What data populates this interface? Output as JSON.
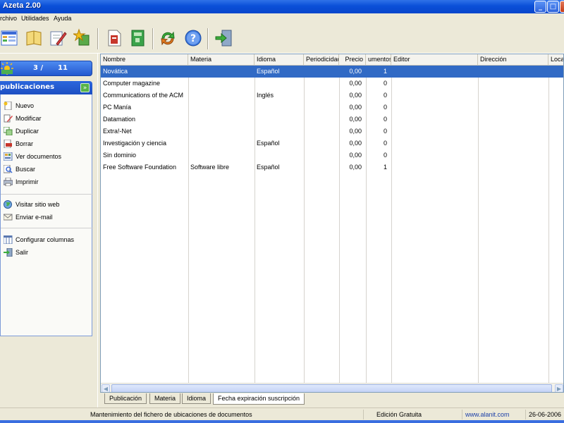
{
  "window": {
    "title": "Azeta 2.00"
  },
  "menu": {
    "items": [
      "rchivo",
      "Utilidades",
      "Ayuda"
    ]
  },
  "toolbar": {
    "buttons": [
      {
        "icon": "grid-view-icon"
      },
      {
        "icon": "book-icon"
      },
      {
        "icon": "edit-pencil-icon"
      },
      {
        "icon": "sparkle-star-icon"
      },
      {
        "icon": "document-icon"
      },
      {
        "icon": "green-book-icon"
      },
      {
        "icon": "refresh-arrows-icon"
      },
      {
        "icon": "help-question-icon"
      },
      {
        "icon": "exit-door-icon"
      }
    ]
  },
  "navigator": {
    "counter": "3 /      11"
  },
  "panel": {
    "header": "publicaciones",
    "actions": [
      "Nuevo",
      "Modificar",
      "Duplicar",
      "Borrar",
      "Ver documentos",
      "Buscar",
      "Imprimir"
    ],
    "web": [
      "Visitar sitio web",
      "Enviar e-mail"
    ],
    "system": [
      "Configurar columnas",
      "Salir"
    ]
  },
  "table": {
    "columns": [
      "Nombre",
      "Materia",
      "Idioma",
      "Periodicidad",
      "Precio",
      "umentos",
      "Editor",
      "Dirección",
      "Loca"
    ],
    "rows": [
      {
        "nombre": "Novática",
        "materia": "",
        "idioma": "Español",
        "periodicidad": "",
        "precio": "0,00",
        "documentos": "1",
        "selected": true
      },
      {
        "nombre": "Computer magazine",
        "materia": "",
        "idioma": "",
        "periodicidad": "",
        "precio": "0,00",
        "documentos": "0"
      },
      {
        "nombre": "Communications of the ACM",
        "materia": "",
        "idioma": "Inglés",
        "periodicidad": "",
        "precio": "0,00",
        "documentos": "0"
      },
      {
        "nombre": "PC Manía",
        "materia": "",
        "idioma": "",
        "periodicidad": "",
        "precio": "0,00",
        "documentos": "0"
      },
      {
        "nombre": "Datamation",
        "materia": "",
        "idioma": "",
        "periodicidad": "",
        "precio": "0,00",
        "documentos": "0"
      },
      {
        "nombre": "Extra!-Net",
        "materia": "",
        "idioma": "",
        "periodicidad": "",
        "precio": "0,00",
        "documentos": "0"
      },
      {
        "nombre": "Investigación y ciencia",
        "materia": "",
        "idioma": "Español",
        "periodicidad": "",
        "precio": "0,00",
        "documentos": "0"
      },
      {
        "nombre": "Sin dominio",
        "materia": "",
        "idioma": "",
        "periodicidad": "",
        "precio": "0,00",
        "documentos": "0"
      },
      {
        "nombre": "Free Software Foundation",
        "materia": "Software libre",
        "idioma": "Español",
        "periodicidad": "",
        "precio": "0,00",
        "documentos": "1"
      }
    ]
  },
  "tabs": [
    "Publicación",
    "Materia",
    "Idioma",
    "Fecha expiración suscripción"
  ],
  "status": {
    "message": "Mantenimiento del fichero de ubicaciones de documentos",
    "edition": "Edición Gratuita",
    "website": "www.alanit.com",
    "date": "26-06-2006"
  },
  "colors": {
    "selection": "#316ac5",
    "title_bar": "#0a4fd8",
    "panel_header": "#2b66dd"
  }
}
